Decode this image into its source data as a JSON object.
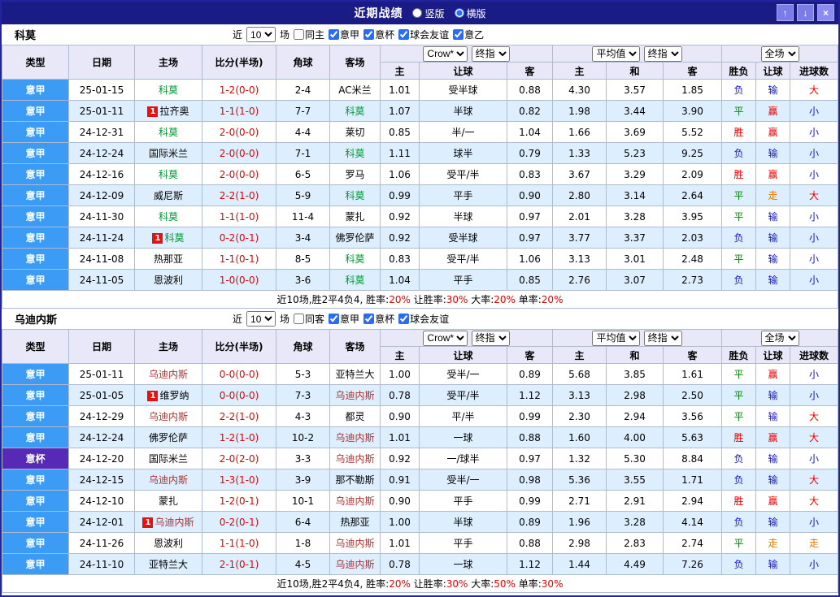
{
  "titlebar": {
    "title": "近期战绩",
    "layout_options": [
      {
        "label": "竖版",
        "checked": false
      },
      {
        "label": "横版",
        "checked": true
      }
    ],
    "up_icon": "↑",
    "down_icon": "↓",
    "close_icon": "×"
  },
  "colors": {
    "league_bg": {
      "意甲": "#3b9bf5",
      "意杯": "#5629b6"
    },
    "score_text": "#e60000",
    "badge_bg": "#e81111",
    "result_text": {
      "胜": "#e60000",
      "平": "#008800",
      "负": "#1515cc",
      "赢": "#e60000",
      "输": "#1515cc",
      "走": "#e07800",
      "大": "#e60000",
      "小": "#1515cc"
    }
  },
  "sections": [
    {
      "team": "科莫",
      "focal_color": "#009933",
      "filter": {
        "near_label": "近",
        "count": "10",
        "games_label": "场",
        "checkboxes": [
          {
            "label": "同主",
            "checked": false
          },
          {
            "label": "意甲",
            "checked": true
          },
          {
            "label": "意杯",
            "checked": true
          },
          {
            "label": "球会友谊",
            "checked": true
          },
          {
            "label": "意乙",
            "checked": true
          }
        ]
      },
      "selects": {
        "odds_source": "Crow*",
        "odds_time1": "终指",
        "avg_source": "平均值",
        "odds_time2": "终指",
        "scope": "全场"
      },
      "headers": {
        "main": [
          "类型",
          "日期",
          "主场",
          "比分(半场)",
          "角球",
          "客场"
        ],
        "sub": [
          "主",
          "让球",
          "客",
          "主",
          "和",
          "客",
          "胜负",
          "让球",
          "进球数"
        ]
      },
      "rows": [
        {
          "league": "意甲",
          "date": "25-01-15",
          "home": {
            "name": "科莫",
            "focal": true,
            "badge": ""
          },
          "score": "1-2(0-0)",
          "corner": "2-4",
          "away": {
            "name": "AC米兰",
            "focal": false,
            "badge": ""
          },
          "odds": [
            "1.01",
            "受半球",
            "0.88"
          ],
          "avg": [
            "4.30",
            "3.57",
            "1.85"
          ],
          "result": [
            "负",
            "输",
            "大"
          ]
        },
        {
          "league": "意甲",
          "date": "25-01-11",
          "home": {
            "name": "拉齐奥",
            "focal": false,
            "badge": "1"
          },
          "score": "1-1(1-0)",
          "corner": "7-7",
          "away": {
            "name": "科莫",
            "focal": true,
            "badge": ""
          },
          "odds": [
            "1.07",
            "半球",
            "0.82"
          ],
          "avg": [
            "1.98",
            "3.44",
            "3.90"
          ],
          "result": [
            "平",
            "赢",
            "小"
          ]
        },
        {
          "league": "意甲",
          "date": "24-12-31",
          "home": {
            "name": "科莫",
            "focal": true,
            "badge": ""
          },
          "score": "2-0(0-0)",
          "corner": "4-4",
          "away": {
            "name": "莱切",
            "focal": false,
            "badge": ""
          },
          "odds": [
            "0.85",
            "半/一",
            "1.04"
          ],
          "avg": [
            "1.66",
            "3.69",
            "5.52"
          ],
          "result": [
            "胜",
            "赢",
            "小"
          ]
        },
        {
          "league": "意甲",
          "date": "24-12-24",
          "home": {
            "name": "国际米兰",
            "focal": false,
            "badge": ""
          },
          "score": "2-0(0-0)",
          "corner": "7-1",
          "away": {
            "name": "科莫",
            "focal": true,
            "badge": ""
          },
          "odds": [
            "1.11",
            "球半",
            "0.79"
          ],
          "avg": [
            "1.33",
            "5.23",
            "9.25"
          ],
          "result": [
            "负",
            "输",
            "小"
          ]
        },
        {
          "league": "意甲",
          "date": "24-12-16",
          "home": {
            "name": "科莫",
            "focal": true,
            "badge": ""
          },
          "score": "2-0(0-0)",
          "corner": "6-5",
          "away": {
            "name": "罗马",
            "focal": false,
            "badge": ""
          },
          "odds": [
            "1.06",
            "受平/半",
            "0.83"
          ],
          "avg": [
            "3.67",
            "3.29",
            "2.09"
          ],
          "result": [
            "胜",
            "赢",
            "小"
          ]
        },
        {
          "league": "意甲",
          "date": "24-12-09",
          "home": {
            "name": "威尼斯",
            "focal": false,
            "badge": ""
          },
          "score": "2-2(1-0)",
          "corner": "5-9",
          "away": {
            "name": "科莫",
            "focal": true,
            "badge": ""
          },
          "odds": [
            "0.99",
            "平手",
            "0.90"
          ],
          "avg": [
            "2.80",
            "3.14",
            "2.64"
          ],
          "result": [
            "平",
            "走",
            "大"
          ]
        },
        {
          "league": "意甲",
          "date": "24-11-30",
          "home": {
            "name": "科莫",
            "focal": true,
            "badge": ""
          },
          "score": "1-1(1-0)",
          "corner": "11-4",
          "away": {
            "name": "蒙扎",
            "focal": false,
            "badge": ""
          },
          "odds": [
            "0.92",
            "半球",
            "0.97"
          ],
          "avg": [
            "2.01",
            "3.28",
            "3.95"
          ],
          "result": [
            "平",
            "输",
            "小"
          ]
        },
        {
          "league": "意甲",
          "date": "24-11-24",
          "home": {
            "name": "科莫",
            "focal": true,
            "badge": "1"
          },
          "score": "0-2(0-1)",
          "corner": "3-4",
          "away": {
            "name": "佛罗伦萨",
            "focal": false,
            "badge": ""
          },
          "odds": [
            "0.92",
            "受半球",
            "0.97"
          ],
          "avg": [
            "3.77",
            "3.37",
            "2.03"
          ],
          "result": [
            "负",
            "输",
            "小"
          ]
        },
        {
          "league": "意甲",
          "date": "24-11-08",
          "home": {
            "name": "热那亚",
            "focal": false,
            "badge": ""
          },
          "score": "1-1(0-1)",
          "corner": "8-5",
          "away": {
            "name": "科莫",
            "focal": true,
            "badge": ""
          },
          "odds": [
            "0.83",
            "受平/半",
            "1.06"
          ],
          "avg": [
            "3.13",
            "3.01",
            "2.48"
          ],
          "result": [
            "平",
            "输",
            "小"
          ]
        },
        {
          "league": "意甲",
          "date": "24-11-05",
          "home": {
            "name": "恩波利",
            "focal": false,
            "badge": ""
          },
          "score": "1-0(0-0)",
          "corner": "3-6",
          "away": {
            "name": "科莫",
            "focal": true,
            "badge": ""
          },
          "odds": [
            "1.04",
            "平手",
            "0.85"
          ],
          "avg": [
            "2.76",
            "3.07",
            "2.73"
          ],
          "result": [
            "负",
            "输",
            "小"
          ]
        }
      ],
      "footer": [
        {
          "text": "近10场,胜2平4负4, ",
          "color": "#000000"
        },
        {
          "text": "胜率:",
          "color": "#000000"
        },
        {
          "text": "20%",
          "color": "#e60000"
        },
        {
          "text": " 让胜率:",
          "color": "#000000"
        },
        {
          "text": "30%",
          "color": "#e60000"
        },
        {
          "text": " 大率:",
          "color": "#000000"
        },
        {
          "text": "20%",
          "color": "#e60000"
        },
        {
          "text": " 单率:",
          "color": "#000000"
        },
        {
          "text": "20%",
          "color": "#e60000"
        }
      ]
    },
    {
      "team": "乌迪内斯",
      "focal_color": "#aa3333",
      "filter": {
        "near_label": "近",
        "count": "10",
        "games_label": "场",
        "checkboxes": [
          {
            "label": "同客",
            "checked": false
          },
          {
            "label": "意甲",
            "checked": true
          },
          {
            "label": "意杯",
            "checked": true
          },
          {
            "label": "球会友谊",
            "checked": true
          }
        ]
      },
      "selects": {
        "odds_source": "Crow*",
        "odds_time1": "终指",
        "avg_source": "平均值",
        "odds_time2": "终指",
        "scope": "全场"
      },
      "headers": {
        "main": [
          "类型",
          "日期",
          "主场",
          "比分(半场)",
          "角球",
          "客场"
        ],
        "sub": [
          "主",
          "让球",
          "客",
          "主",
          "和",
          "客",
          "胜负",
          "让球",
          "进球数"
        ]
      },
      "rows": [
        {
          "league": "意甲",
          "date": "25-01-11",
          "home": {
            "name": "乌迪内斯",
            "focal": true,
            "badge": ""
          },
          "score": "0-0(0-0)",
          "corner": "5-3",
          "away": {
            "name": "亚特兰大",
            "focal": false,
            "badge": ""
          },
          "odds": [
            "1.00",
            "受半/一",
            "0.89"
          ],
          "avg": [
            "5.68",
            "3.85",
            "1.61"
          ],
          "result": [
            "平",
            "赢",
            "小"
          ]
        },
        {
          "league": "意甲",
          "date": "25-01-05",
          "home": {
            "name": "维罗纳",
            "focal": false,
            "badge": "1"
          },
          "score": "0-0(0-0)",
          "corner": "7-3",
          "away": {
            "name": "乌迪内斯",
            "focal": true,
            "badge": ""
          },
          "odds": [
            "0.78",
            "受平/半",
            "1.12"
          ],
          "avg": [
            "3.13",
            "2.98",
            "2.50"
          ],
          "result": [
            "平",
            "输",
            "小"
          ]
        },
        {
          "league": "意甲",
          "date": "24-12-29",
          "home": {
            "name": "乌迪内斯",
            "focal": true,
            "badge": ""
          },
          "score": "2-2(1-0)",
          "corner": "4-3",
          "away": {
            "name": "都灵",
            "focal": false,
            "badge": ""
          },
          "odds": [
            "0.90",
            "平/半",
            "0.99"
          ],
          "avg": [
            "2.30",
            "2.94",
            "3.56"
          ],
          "result": [
            "平",
            "输",
            "大"
          ]
        },
        {
          "league": "意甲",
          "date": "24-12-24",
          "home": {
            "name": "佛罗伦萨",
            "focal": false,
            "badge": ""
          },
          "score": "1-2(1-0)",
          "corner": "10-2",
          "away": {
            "name": "乌迪内斯",
            "focal": true,
            "badge": ""
          },
          "odds": [
            "1.01",
            "一球",
            "0.88"
          ],
          "avg": [
            "1.60",
            "4.00",
            "5.63"
          ],
          "result": [
            "胜",
            "赢",
            "大"
          ]
        },
        {
          "league": "意杯",
          "date": "24-12-20",
          "home": {
            "name": "国际米兰",
            "focal": false,
            "badge": ""
          },
          "score": "2-0(2-0)",
          "corner": "3-3",
          "away": {
            "name": "乌迪内斯",
            "focal": true,
            "badge": ""
          },
          "odds": [
            "0.92",
            "一/球半",
            "0.97"
          ],
          "avg": [
            "1.32",
            "5.30",
            "8.84"
          ],
          "result": [
            "负",
            "输",
            "小"
          ]
        },
        {
          "league": "意甲",
          "date": "24-12-15",
          "home": {
            "name": "乌迪内斯",
            "focal": true,
            "badge": ""
          },
          "score": "1-3(1-0)",
          "corner": "3-9",
          "away": {
            "name": "那不勒斯",
            "focal": false,
            "badge": ""
          },
          "odds": [
            "0.91",
            "受半/一",
            "0.98"
          ],
          "avg": [
            "5.36",
            "3.55",
            "1.71"
          ],
          "result": [
            "负",
            "输",
            "大"
          ]
        },
        {
          "league": "意甲",
          "date": "24-12-10",
          "home": {
            "name": "蒙扎",
            "focal": false,
            "badge": ""
          },
          "score": "1-2(0-1)",
          "corner": "10-1",
          "away": {
            "name": "乌迪内斯",
            "focal": true,
            "badge": ""
          },
          "odds": [
            "0.90",
            "平手",
            "0.99"
          ],
          "avg": [
            "2.71",
            "2.91",
            "2.94"
          ],
          "result": [
            "胜",
            "赢",
            "大"
          ]
        },
        {
          "league": "意甲",
          "date": "24-12-01",
          "home": {
            "name": "乌迪内斯",
            "focal": true,
            "badge": "1"
          },
          "score": "0-2(0-1)",
          "corner": "6-4",
          "away": {
            "name": "热那亚",
            "focal": false,
            "badge": ""
          },
          "odds": [
            "1.00",
            "半球",
            "0.89"
          ],
          "avg": [
            "1.96",
            "3.28",
            "4.14"
          ],
          "result": [
            "负",
            "输",
            "小"
          ]
        },
        {
          "league": "意甲",
          "date": "24-11-26",
          "home": {
            "name": "恩波利",
            "focal": false,
            "badge": ""
          },
          "score": "1-1(1-0)",
          "corner": "1-8",
          "away": {
            "name": "乌迪内斯",
            "focal": true,
            "badge": ""
          },
          "odds": [
            "1.01",
            "平手",
            "0.88"
          ],
          "avg": [
            "2.98",
            "2.83",
            "2.74"
          ],
          "result": [
            "平",
            "走",
            "走"
          ]
        },
        {
          "league": "意甲",
          "date": "24-11-10",
          "home": {
            "name": "亚特兰大",
            "focal": false,
            "badge": ""
          },
          "score": "2-1(0-1)",
          "corner": "4-5",
          "away": {
            "name": "乌迪内斯",
            "focal": true,
            "badge": ""
          },
          "odds": [
            "0.78",
            "一球",
            "1.12"
          ],
          "avg": [
            "1.44",
            "4.49",
            "7.26"
          ],
          "result": [
            "负",
            "输",
            "小"
          ]
        }
      ],
      "footer": [
        {
          "text": "近10场,胜2平4负4, ",
          "color": "#000000"
        },
        {
          "text": "胜率:",
          "color": "#000000"
        },
        {
          "text": "20%",
          "color": "#e60000"
        },
        {
          "text": " 让胜率:",
          "color": "#000000"
        },
        {
          "text": "30%",
          "color": "#e60000"
        },
        {
          "text": " 大率:",
          "color": "#000000"
        },
        {
          "text": "50%",
          "color": "#e60000"
        },
        {
          "text": " 单率:",
          "color": "#000000"
        },
        {
          "text": "30%",
          "color": "#e60000"
        }
      ]
    }
  ]
}
